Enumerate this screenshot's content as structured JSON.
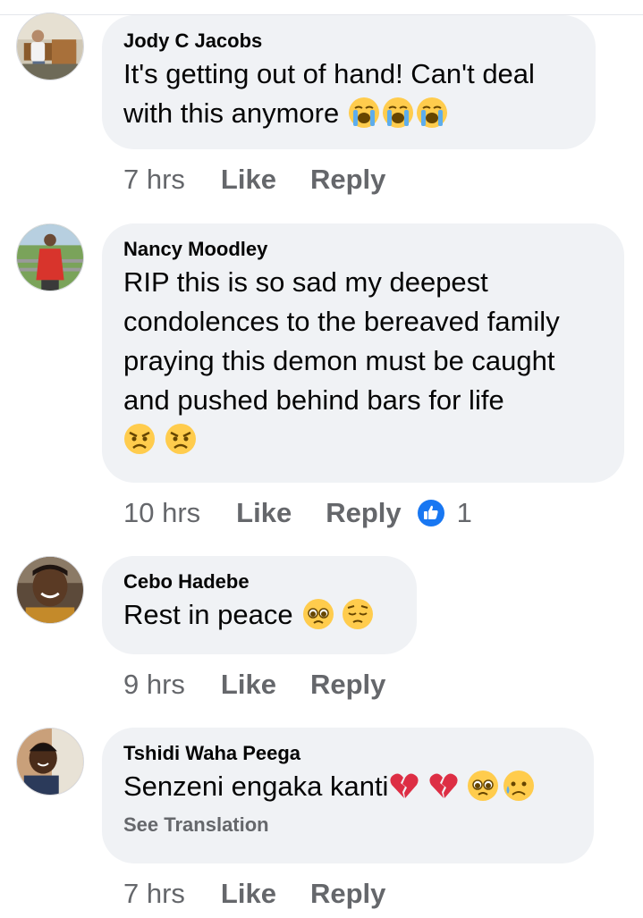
{
  "comments": [
    {
      "author": "Jody C Jacobs",
      "text": "It's getting out of hand! Can't deal with this anymore",
      "emojis": [
        "loudly-crying-face",
        "loudly-crying-face",
        "loudly-crying-face"
      ],
      "time": "7 hrs",
      "like_label": "Like",
      "reply_label": "Reply"
    },
    {
      "author": "Nancy Moodley",
      "text": "RIP this is so sad my deepest condolences to the bereaved family praying this demon must be caught and pushed behind bars for life",
      "emojis": [
        "angry-face",
        "angry-face"
      ],
      "time": "10 hrs",
      "like_label": "Like",
      "reply_label": "Reply",
      "reaction_count": "1",
      "reaction_icon": "like-reaction-icon"
    },
    {
      "author": "Cebo Hadebe",
      "text": "Rest in peace",
      "emojis": [
        "pleading-face",
        "pensive-face"
      ],
      "time": "9 hrs",
      "like_label": "Like",
      "reply_label": "Reply"
    },
    {
      "author": "Tshidi Waha Peega",
      "text": "Senzeni engaka kanti",
      "emojis": [
        "broken-heart",
        "broken-heart",
        "pleading-face",
        "sad-but-relieved-face"
      ],
      "see_translation": "See Translation",
      "time": "7 hrs",
      "like_label": "Like",
      "reply_label": "Reply"
    }
  ],
  "colors": {
    "bubble": "#f0f2f5",
    "meta_text": "#65676b",
    "primary_text": "#050505",
    "like_blue": "#1877f2"
  }
}
